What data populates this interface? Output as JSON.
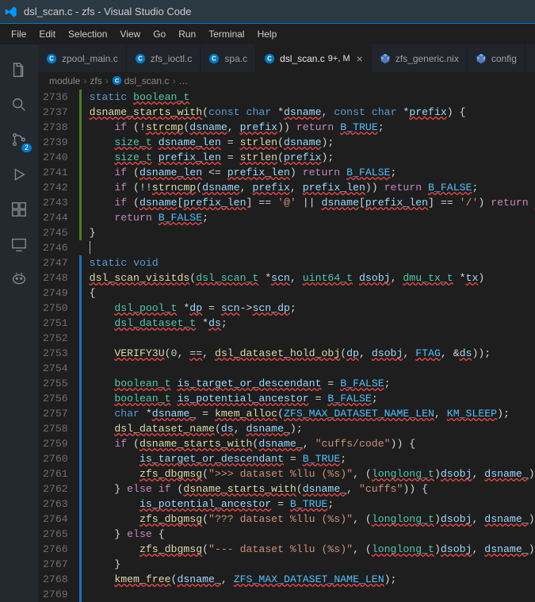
{
  "window_title": "dsl_scan.c - zfs - Visual Studio Code",
  "menubar": [
    "File",
    "Edit",
    "Selection",
    "View",
    "Go",
    "Run",
    "Terminal",
    "Help"
  ],
  "activitybar": {
    "scm_badge": "2"
  },
  "tabs": [
    {
      "label": "zpool_main.c",
      "icon": "c",
      "active": false,
      "mod": ""
    },
    {
      "label": "zfs_ioctl.c",
      "icon": "c",
      "active": false,
      "mod": ""
    },
    {
      "label": "spa.c",
      "icon": "c",
      "active": false,
      "mod": ""
    },
    {
      "label": "dsl_scan.c",
      "icon": "c",
      "active": true,
      "mod": "9+, M"
    },
    {
      "label": "zfs_generic.nix",
      "icon": "nix",
      "active": false,
      "mod": ""
    },
    {
      "label": "config",
      "icon": "nix",
      "active": false,
      "mod": ""
    }
  ],
  "breadcrumb": [
    "module",
    "zfs",
    "dsl_scan.c",
    "…"
  ],
  "line_start": 2736,
  "line_count": 34,
  "mod_segments": [
    {
      "lines": 10,
      "class": "green"
    },
    {
      "lines": 1,
      "class": ""
    },
    {
      "lines": 23,
      "class": "blue"
    }
  ],
  "code_lines": [
    "<span class='kw'>static</span> <span class='type err'>boolean_t</span>",
    "<span class='fn err'>dsname_starts_with</span>(<span class='kw'>const</span> <span class='kw'>char</span> *<span class='param err'>dsname</span>, <span class='kw'>const</span> <span class='kw'>char</span> *<span class='param err'>prefix</span>) {",
    "    <span class='macro'>if</span> (!<span class='fn err'>strcmp</span>(<span class='param err'>dsname</span>, <span class='param err'>prefix</span>)) <span class='macro'>return</span> <span class='const err'>B_TRUE</span>;",
    "    <span class='type err'>size_t</span> <span class='param err'>dsname_len</span> = <span class='fn err'>strlen</span>(<span class='param err'>dsname</span>);",
    "    <span class='type err'>size_t</span> <span class='param err'>prefix_len</span> = <span class='fn err'>strlen</span>(<span class='param err'>prefix</span>);",
    "    <span class='macro'>if</span> (<span class='param err'>dsname_len</span> &lt;= <span class='param err'>prefix_len</span>) <span class='macro'>return</span> <span class='const err'>B_FALSE</span>;",
    "    <span class='macro'>if</span> (!!<span class='fn err'>strncmp</span>(<span class='param err'>dsname</span>, <span class='param err'>prefix</span>, <span class='param err'>prefix_len</span>)) <span class='macro'>return</span> <span class='const err'>B_FALSE</span>;",
    "    <span class='macro'>if</span> (<span class='param err'>dsname</span>[<span class='param err'>prefix_len</span>] == <span class='str'>'@'</span> || <span class='param err'>dsname</span>[<span class='param err'>prefix_len</span>] == <span class='str'>'/'</span>) <span class='macro'>return</span> <span class='const err'>B_TRUE</span>;",
    "    <span class='macro'>return</span> <span class='const err'>B_FALSE</span>;",
    "}",
    "<span class='cursor'></span>",
    "<span class='kw'>static</span> <span class='kw'>void</span>",
    "<span class='fn err'>dsl_scan_visitds</span>(<span class='type err'>dsl_scan_t</span> *<span class='param err'>scn</span>, <span class='type err'>uint64_t</span> <span class='param err'>dsobj</span>, <span class='type err'>dmu_tx_t</span> *<span class='param err'>tx</span>)",
    "{",
    "    <span class='type err'>dsl_pool_t</span> *<span class='param err'>dp</span> = <span class='param err'>scn</span>-&gt;<span class='param err'>scn_dp</span>;",
    "    <span class='type err'>dsl_dataset_t</span> *<span class='param err'>ds</span>;",
    "",
    "    <span class='fn err'>VERIFY3U</span>(<span class='num'>0</span>, <span class='err'>==</span>, <span class='fn err'>dsl_dataset_hold_obj</span>(<span class='param err'>dp</span>, <span class='param err'>dsobj</span>, <span class='const err'>FTAG</span>, &amp;<span class='param err'>ds</span>));",
    "",
    "    <span class='type err'>boolean_t</span> <span class='param err'>is_target_or_descendant</span> = <span class='const err'>B_FALSE</span>;",
    "    <span class='type err'>boolean_t</span> <span class='param err'>is_potential_ancestor</span> = <span class='const err'>B_FALSE</span>;",
    "    <span class='kw'>char</span> *<span class='param err'>dsname_</span> = <span class='fn err'>kmem_alloc</span>(<span class='const err'>ZFS_MAX_DATASET_NAME_LEN</span>, <span class='const err'>KM_SLEEP</span>);",
    "    <span class='fn err'>dsl_dataset_name</span>(<span class='param err'>ds</span>, <span class='param err'>dsname_</span>);",
    "    <span class='macro'>if</span> (<span class='fn err'>dsname_starts_with</span>(<span class='param err'>dsname_</span>, <span class='str'>\"cuffs/code\"</span>)) {",
    "        <span class='param err'>is_target_or_descendant</span> = <span class='const err'>B_TRUE</span>;",
    "        <span class='fn err'>zfs_dbgmsg</span>(<span class='str'>\"&gt;&gt;&gt; dataset %llu (%s)\"</span>, (<span class='type err'>longlong_t</span>)<span class='param err'>dsobj</span>, <span class='param err'>dsname_</span>);",
    "    } <span class='macro'>else</span> <span class='macro'>if</span> (<span class='fn err'>dsname_starts_with</span>(<span class='param err'>dsname_</span>, <span class='str'>\"cuffs\"</span>)) {",
    "        <span class='param err'>is_potential_ancestor</span> = <span class='const err'>B_TRUE</span>;",
    "        <span class='fn err'>zfs_dbgmsg</span>(<span class='str'>\"??? dataset %llu (%s)\"</span>, (<span class='type err'>longlong_t</span>)<span class='param err'>dsobj</span>, <span class='param err'>dsname_</span>);",
    "    } <span class='macro'>else</span> {",
    "        <span class='fn err'>zfs_dbgmsg</span>(<span class='str'>\"--- dataset %llu (%s)\"</span>, (<span class='type err'>longlong_t</span>)<span class='param err'>dsobj</span>, <span class='param err'>dsname_</span>);",
    "    }",
    "    <span class='fn err'>kmem_free</span>(<span class='param err'>dsname_</span>, <span class='const err'>ZFS_MAX_DATASET_NAME_LEN</span>);",
    ""
  ]
}
